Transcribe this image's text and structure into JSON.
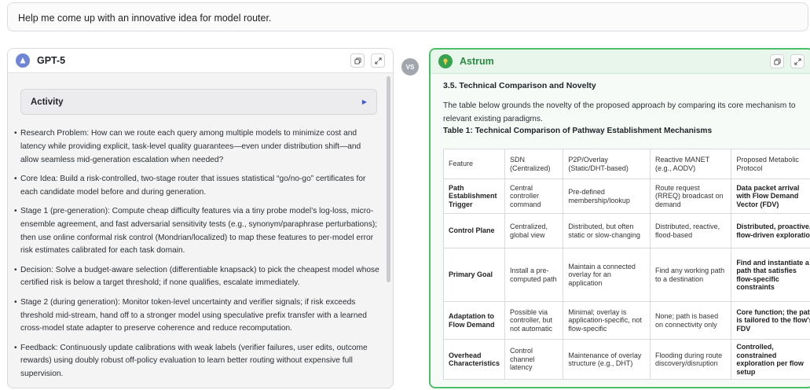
{
  "prompt": "Help me come up with an innovative idea for model router.",
  "vs_label": "VS",
  "left": {
    "model_name": "GPT-5",
    "activity_label": "Activity",
    "bullets": [
      "Research Problem: How can we route each query among multiple models to minimize cost and latency while providing explicit, task-level quality guarantees—even under distribution shift—and allow seamless mid-generation escalation when needed?",
      "Core Idea: Build a risk-controlled, two-stage router that issues statistical “go/no-go” certificates for each candidate model before and during generation.",
      "Stage 1 (pre-generation): Compute cheap difficulty features via a tiny probe model’s log-loss, micro-ensemble agreement, and fast adversarial sensitivity tests (e.g., synonym/paraphrase perturbations); then use online conformal risk control (Mondrian/localized) to map these features to per-model error risk estimates calibrated for each task domain.",
      "Decision: Solve a budget-aware selection (differentiable knapsack) to pick the cheapest model whose certified risk is below a target threshold; if none qualifies, escalate immediately.",
      "Stage 2 (during generation): Monitor token-level uncertainty and verifier signals; if risk exceeds threshold mid-stream, hand off to a stronger model using speculative prefix transfer with a learned cross-model state adapter to preserve coherence and reduce recomputation.",
      "Feedback: Continuously update calibrations with weak labels (verifier failures, user edits, outcome rewards) using doubly robust off-policy evaluation to learn better routing without expensive full supervision."
    ]
  },
  "right": {
    "model_name": "Astrum",
    "section_heading": "3.5. Technical Comparison and Novelty",
    "paragraph": "The table below grounds the novelty of the proposed approach by comparing its core mechanism to relevant existing paradigms.",
    "table_caption": "Table 1: Technical Comparison of Pathway Establishment Mechanisms",
    "table": {
      "headers": [
        "Feature",
        "SDN (Centralized)",
        "P2P/Overlay (Static/DHT-based)",
        "Reactive MANET (e.g., AODV)",
        "Proposed Metabolic Protocol"
      ],
      "rows": [
        [
          "Path Establishment Trigger",
          "Central controller command",
          "Pre-defined membership/lookup",
          "Route request (RREQ) broadcast on demand",
          "Data packet arrival with Flow Demand Vector (FDV)"
        ],
        [
          "Control Plane",
          "Centralized, global view",
          "Distributed, but often static or slow-changing",
          "Distributed, reactive, flood-based",
          "Distributed, proactive, flow-driven exploration"
        ],
        [
          "Primary Goal",
          "Install a pre-computed path",
          "Maintain a connected overlay for an application",
          "Find any working path to a destination",
          "Find and instantiate a path that satisfies flow-specific constraints"
        ],
        [
          "Adaptation to Flow Demand",
          "Possible via controller, but not automatic",
          "Minimal; overlay is application-specific, not flow-specific",
          "None; path is based on connectivity only",
          "Core function; the path is tailored to the flow's FDV"
        ],
        [
          "Overhead Characteristics",
          "Control channel latency",
          "Maintenance of overlay structure (e.g., DHT)",
          "Flooding during route discovery/disruption",
          "Controlled, constrained exploration per flow setup"
        ]
      ]
    }
  },
  "colors": {
    "winner_border": "#4cbf6a",
    "winner_header": "#e8f6ec",
    "activity_arrow": "#3b5bdb"
  }
}
